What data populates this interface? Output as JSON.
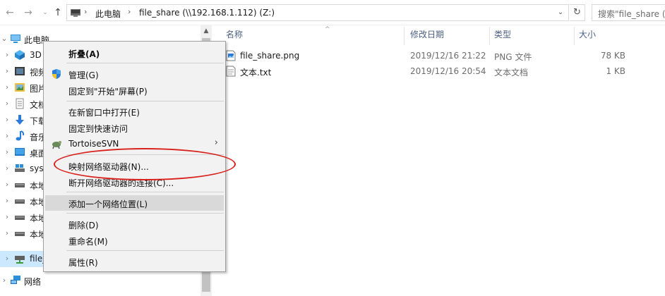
{
  "address": {
    "crumbs": [
      "此电脑",
      "file_share (\\\\192.168.1.112) (Z:)"
    ],
    "search_placeholder": "搜索\"file_share (Z:)\""
  },
  "nav": {
    "items": [
      {
        "label": "此电脑",
        "icon": "pc-icon",
        "level": 0,
        "expanded": true,
        "selected": false
      },
      {
        "label": "3D",
        "icon": "3d-objects-icon",
        "level": 1
      },
      {
        "label": "视频",
        "icon": "video-folder-icon",
        "level": 1
      },
      {
        "label": "图片",
        "icon": "pictures-folder-icon",
        "level": 1
      },
      {
        "label": "文档",
        "icon": "documents-folder-icon",
        "level": 1
      },
      {
        "label": "下载",
        "icon": "downloads-folder-icon",
        "level": 1
      },
      {
        "label": "音乐",
        "icon": "music-folder-icon",
        "level": 1
      },
      {
        "label": "桌面",
        "icon": "desktop-folder-icon",
        "level": 1
      },
      {
        "label": "sys",
        "icon": "system-drive-icon",
        "level": 1
      },
      {
        "label": "本地",
        "icon": "local-drive-icon",
        "level": 1
      },
      {
        "label": "本地",
        "icon": "local-drive-icon",
        "level": 1
      },
      {
        "label": "本地",
        "icon": "local-drive-icon",
        "level": 1
      },
      {
        "label": "本地",
        "icon": "local-drive-icon",
        "level": 1
      },
      {
        "label": "file_",
        "icon": "network-drive-icon",
        "level": 1,
        "selected": true
      },
      {
        "label": "网络",
        "icon": "network-icon",
        "level": 0
      }
    ]
  },
  "columns": {
    "name": "名称",
    "modified": "修改日期",
    "type": "类型",
    "size": "大小"
  },
  "files": [
    {
      "name": "file_share.png",
      "modified": "2019/12/16 21:22",
      "type": "PNG 文件",
      "size": "78 KB",
      "icon": "image-file-icon"
    },
    {
      "name": "文本.txt",
      "modified": "2019/12/16 20:54",
      "type": "文本文档",
      "size": "1 KB",
      "icon": "text-file-icon"
    }
  ],
  "context_menu": {
    "collapse": "折叠(A)",
    "manage": "管理(G)",
    "pin_start": "固定到\"开始\"屏幕(P)",
    "open_new_window": "在新窗口中打开(E)",
    "pin_quick_access": "固定到快速访问",
    "tortoisesvn": "TortoiseSVN",
    "map_drive": "映射网络驱动器(N)...",
    "disconnect_drive": "断开网络驱动器的连接(C)...",
    "add_network_location": "添加一个网络位置(L)",
    "delete": "删除(D)",
    "rename": "重命名(M)",
    "properties": "属性(R)"
  },
  "colors": {
    "selected_bg": "#cce8ff",
    "annotation": "#d9201a",
    "header_text": "#4d6082"
  }
}
